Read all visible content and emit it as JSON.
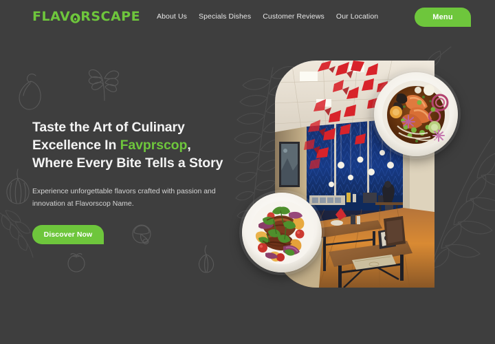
{
  "theme": {
    "background": "#3e3e3e",
    "accent": "#6ec63c",
    "text_primary": "#f4f4f4",
    "text_secondary": "#d6d6d6",
    "doodle_stroke": "#5a5a5a"
  },
  "header": {
    "logo": {
      "text_before": "FLAV",
      "text_after": "RSCAPE",
      "mark_icon": "avocado-leaf-icon",
      "full_text": "FLAVORSCAPE"
    },
    "nav": [
      {
        "label": "About Us",
        "name": "nav-link-about-us"
      },
      {
        "label": "Specials Dishes",
        "name": "nav-link-specials-dishes"
      },
      {
        "label": "Customer Reviews",
        "name": "nav-link-customer-reviews"
      },
      {
        "label": "Our Location",
        "name": "nav-link-our-location"
      }
    ],
    "menu_button": "Menu"
  },
  "hero": {
    "headline_line1": "Taste the Art of Culinary",
    "headline_line2_before": "Excellence In ",
    "headline_accent": "Favprscop",
    "headline_line2_after": ",",
    "headline_line3": "Where Every Bite Tells a Story",
    "subcopy": "Experience unforgettable flavors crafted with passion and innovation at Flavorscop Name.",
    "cta_label": "Discover Now"
  },
  "media": {
    "venue_photo_alt": "restaurant-interior-with-blue-wall-and-red-origami-cranes",
    "dish_top_alt": "salmon-in-broth-plate",
    "dish_bottom_alt": "grilled-meat-with-tomatoes-plate"
  },
  "decorations": [
    {
      "name": "eggplant-doodle"
    },
    {
      "name": "parsley-leaf-doodle"
    },
    {
      "name": "garlic-bulb-doodle"
    },
    {
      "name": "herb-branch-doodle"
    },
    {
      "name": "tomato-doodle"
    },
    {
      "name": "mushroom-doodle"
    },
    {
      "name": "onion-doodle"
    },
    {
      "name": "fern-branch-doodle"
    }
  ]
}
